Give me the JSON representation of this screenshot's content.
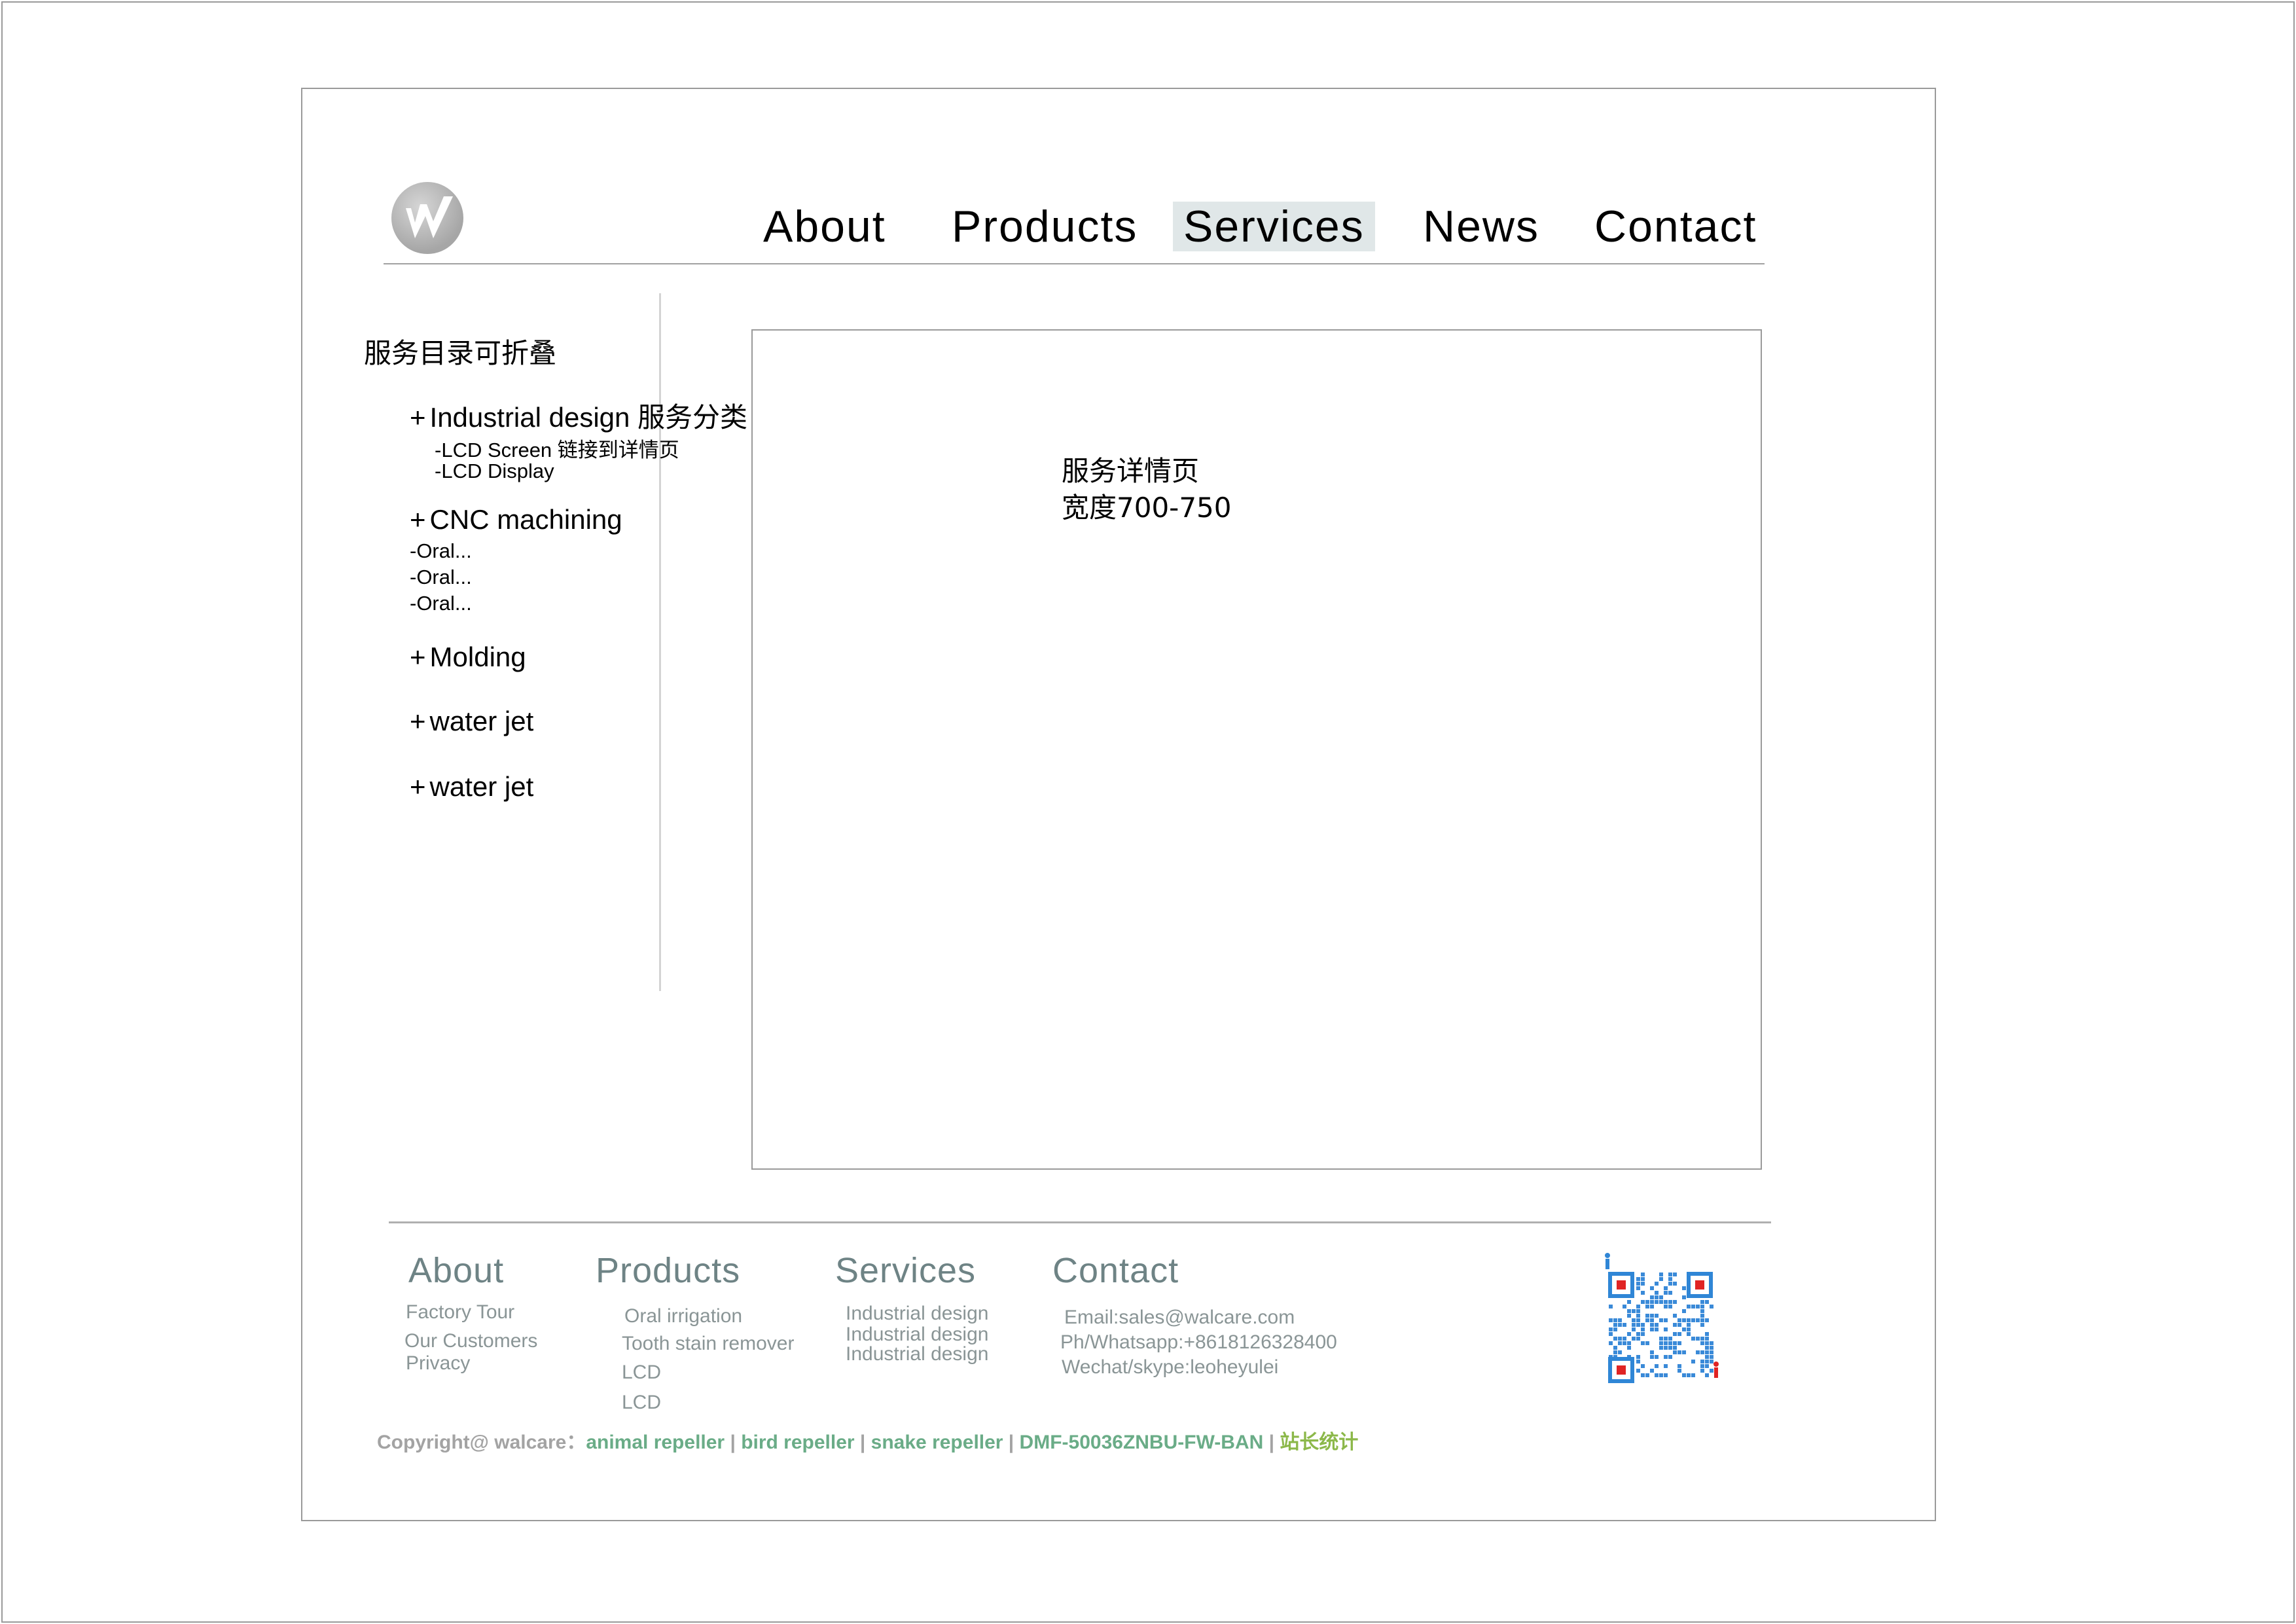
{
  "nav": {
    "items": [
      "About",
      "Products",
      "Services",
      "News",
      "Contact"
    ],
    "active": "Services",
    "active_color": "#e0e7e8"
  },
  "sidebar": {
    "title": "服务目录可折叠",
    "categories": [
      {
        "label": "Industrial design 服务分类",
        "items": [
          "-LCD Screen 链接到详情页",
          "-LCD Display"
        ]
      },
      {
        "label": "CNC machining",
        "items": [
          "-Oral...",
          "-Oral...",
          "-Oral..."
        ]
      },
      {
        "label": "Molding",
        "items": []
      },
      {
        "label": "water jet",
        "items": []
      },
      {
        "label": "water jet",
        "items": []
      }
    ],
    "expand_symbol": "+"
  },
  "main": {
    "note_line1": "服务详情页",
    "note_line2": "宽度700-750"
  },
  "footer": {
    "about": {
      "heading": "About",
      "links": [
        "Factory Tour",
        "Our Customers",
        "Privacy"
      ]
    },
    "products": {
      "heading": "Products",
      "links": [
        "Oral irrigation",
        "Tooth stain remover",
        "LCD",
        "LCD"
      ]
    },
    "services": {
      "heading": "Services",
      "links": [
        "Industrial design",
        "Industrial design",
        "Industrial design"
      ]
    },
    "contact": {
      "heading": "Contact",
      "lines": [
        "Email:sales@walcare.com",
        "Ph/Whatsapp:+8618126328400",
        "Wechat/skype:leoheyulei"
      ]
    },
    "heading_color": "#6e8385",
    "link_color": "#8a9596"
  },
  "copyright": {
    "prefix": "Copyright@ walcare：",
    "links": [
      "animal repeller",
      "bird repeller",
      "snake repeller",
      "DMF-50036ZNBU-FW-BAN"
    ],
    "separator": " | ",
    "stat": "站长统计",
    "link_color": "#6aac87",
    "stat_color": "#8cb84a"
  }
}
